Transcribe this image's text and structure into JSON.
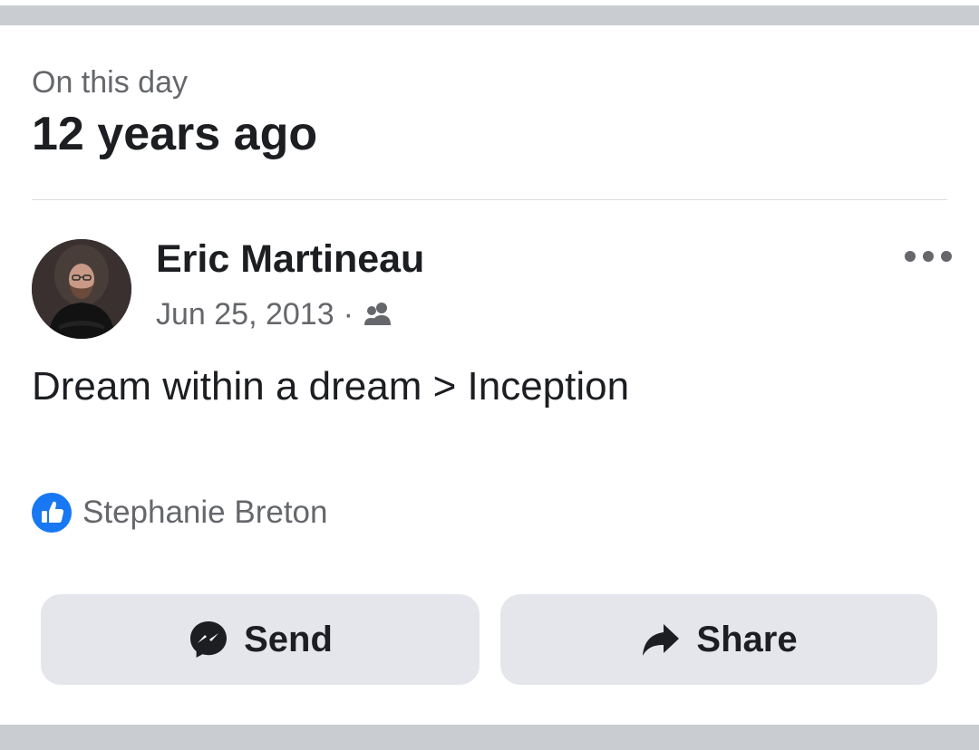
{
  "memory": {
    "kicker": "On this day",
    "title": "12 years ago"
  },
  "post": {
    "author": "Eric Martineau",
    "date": "Jun 25, 2013",
    "separator": "·",
    "audience_icon": "friends-icon",
    "more_icon": "more-options-icon",
    "text": "Dream within a dream > Inception"
  },
  "reactions": {
    "icon": "like-icon",
    "names": "Stephanie Breton"
  },
  "actions": {
    "send": {
      "label": "Send",
      "icon": "messenger-icon"
    },
    "share": {
      "label": "Share",
      "icon": "share-arrow-icon"
    }
  },
  "colors": {
    "like_blue": "#1877f2",
    "button_bg": "#e4e6eb",
    "secondary_text": "#65676b",
    "primary_text": "#1c1e21"
  }
}
